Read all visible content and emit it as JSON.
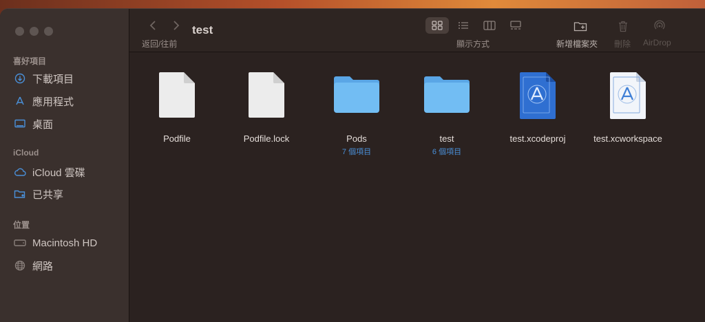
{
  "window": {
    "title": "test",
    "nav_label": "返回/往前",
    "view_label": "顯示方式",
    "new_folder_label": "新增檔案夾",
    "delete_label": "刪除",
    "airdrop_label": "AirDrop"
  },
  "sidebar": {
    "favorites_title": "喜好項目",
    "favorites": [
      {
        "label": "下載項目",
        "icon": "download-icon"
      },
      {
        "label": "應用程式",
        "icon": "applications-icon"
      },
      {
        "label": "桌面",
        "icon": "desktop-icon"
      }
    ],
    "icloud_title": "iCloud",
    "icloud": [
      {
        "label": "iCloud 雲碟",
        "icon": "cloud-icon"
      },
      {
        "label": "已共享",
        "icon": "shared-folder-icon"
      }
    ],
    "locations_title": "位置",
    "locations": [
      {
        "label": "Macintosh HD",
        "icon": "disk-icon"
      },
      {
        "label": "網路",
        "icon": "network-icon"
      }
    ]
  },
  "files": [
    {
      "name": "Podfile",
      "sub": "",
      "kind": "document"
    },
    {
      "name": "Podfile.lock",
      "sub": "",
      "kind": "document"
    },
    {
      "name": "Pods",
      "sub": "7 個項目",
      "kind": "folder"
    },
    {
      "name": "test",
      "sub": "6 個項目",
      "kind": "folder"
    },
    {
      "name": "test.xcodeproj",
      "sub": "",
      "kind": "xcodeproj"
    },
    {
      "name": "test.xcworkspace",
      "sub": "",
      "kind": "xcworkspace"
    }
  ],
  "colors": {
    "accent": "#4a90d9",
    "folder": "#6cb4ee"
  }
}
